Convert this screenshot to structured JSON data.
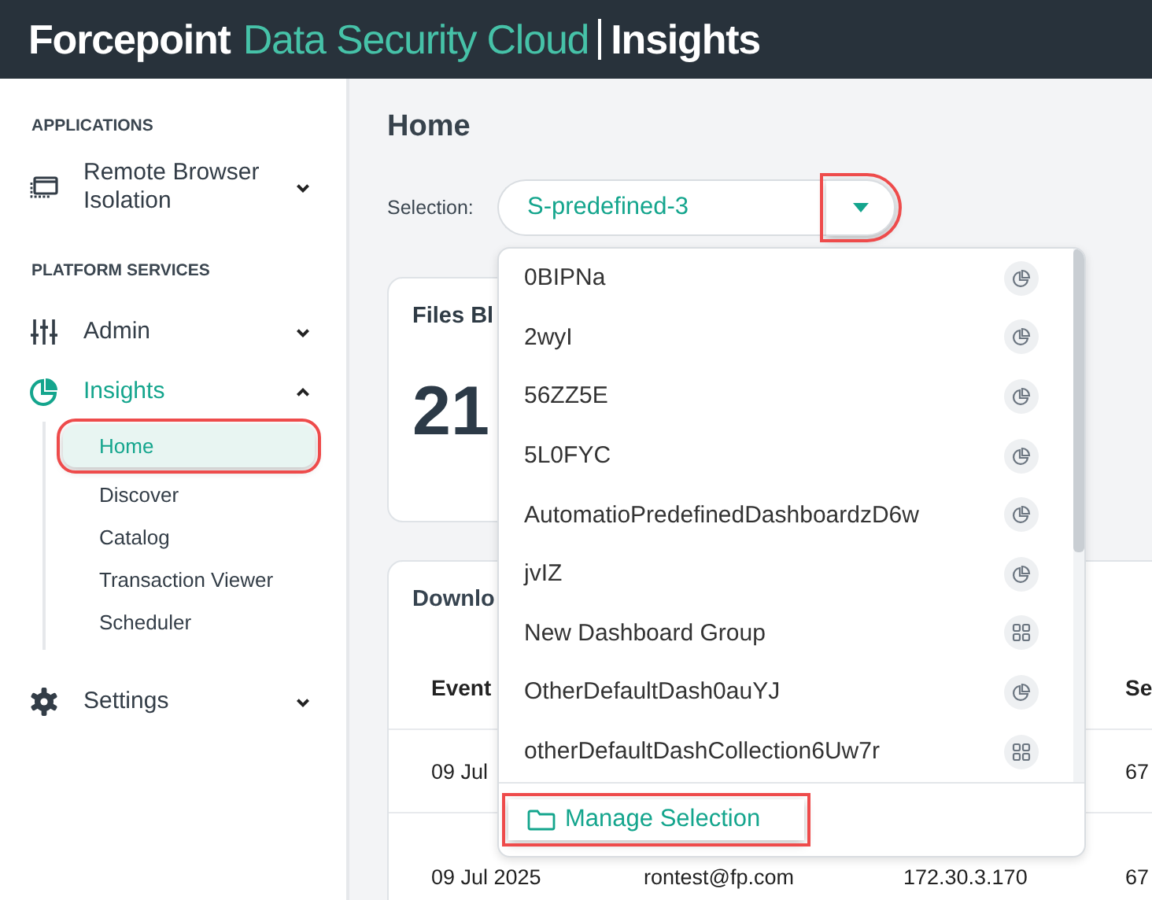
{
  "header": {
    "brand": "Forcepoint",
    "product": "Data Security Cloud",
    "app": "Insights"
  },
  "sidebar": {
    "sections": [
      {
        "heading": "APPLICATIONS",
        "items": [
          {
            "label": "Remote Browser Isolation",
            "kind": "browser",
            "selected": false,
            "expanded": false
          }
        ]
      },
      {
        "heading": "PLATFORM SERVICES",
        "items": [
          {
            "label": "Admin",
            "kind": "sliders",
            "selected": false,
            "expanded": false
          },
          {
            "label": "Insights",
            "kind": "pie",
            "selected": true,
            "expanded": true,
            "children": [
              {
                "label": "Home",
                "selected": true,
                "highlighted": true
              },
              {
                "label": "Discover",
                "selected": false,
                "highlighted": false
              },
              {
                "label": "Catalog",
                "selected": false,
                "highlighted": false
              },
              {
                "label": "Transaction Viewer",
                "selected": false,
                "highlighted": false
              },
              {
                "label": "Scheduler",
                "selected": false,
                "highlighted": false
              }
            ]
          },
          {
            "label": "Settings",
            "kind": "gear",
            "selected": false,
            "expanded": false
          }
        ]
      }
    ]
  },
  "page": {
    "title": "Home",
    "selection": {
      "label": "Selection:",
      "value": "S-predefined-3",
      "caret_highlighted": true
    },
    "cards": [
      {
        "title": "Files Bl",
        "value": "21"
      },
      {
        "title": "Downlo",
        "columns": [
          "Event",
          "",
          "",
          "Se"
        ],
        "rows": [
          [
            "09 Jul",
            "",
            "",
            "67"
          ],
          [
            "09 Jul 2025",
            "rontest@fp.com",
            "172.30.3.170",
            "67"
          ]
        ]
      }
    ],
    "dropdown": {
      "items": [
        {
          "label": "0BIPNa",
          "kind": "dashboard"
        },
        {
          "label": "2wyI",
          "kind": "dashboard"
        },
        {
          "label": "56ZZ5E",
          "kind": "dashboard"
        },
        {
          "label": "5L0FYC",
          "kind": "dashboard"
        },
        {
          "label": "AutomatioPredefinedDashboardzD6w",
          "kind": "dashboard"
        },
        {
          "label": "jvIZ",
          "kind": "dashboard"
        },
        {
          "label": "New Dashboard Group",
          "kind": "group"
        },
        {
          "label": "OtherDefaultDash0auYJ",
          "kind": "dashboard"
        },
        {
          "label": "otherDefaultDashCollection6Uw7r",
          "kind": "group"
        }
      ],
      "footer": {
        "label": "Manage Selection",
        "highlighted": true
      }
    }
  }
}
